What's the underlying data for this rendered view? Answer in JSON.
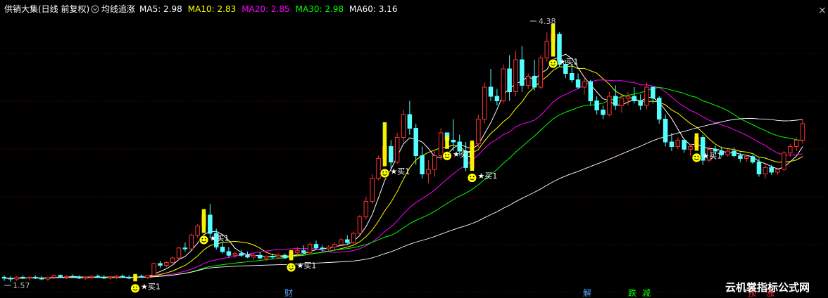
{
  "header": {
    "stock_title": "供销大集(日线 前复权)",
    "indicator_name": "均线追涨",
    "ma_labels": [
      {
        "text": "MA5: 2.98",
        "color": "#ffffff"
      },
      {
        "text": "MA10: 2.83",
        "color": "#ffff00"
      },
      {
        "text": "MA20: 2.85",
        "color": "#ff00ff"
      },
      {
        "text": "MA30: 2.98",
        "color": "#00ff00"
      },
      {
        "text": "MA60: 3.16",
        "color": "#ffffff"
      }
    ]
  },
  "annotations": {
    "high_label": "4.38",
    "low_label": "1.57",
    "signal_label": "买1"
  },
  "events": [
    {
      "text": "财",
      "color": "#4da6ff"
    },
    {
      "text": "解",
      "color": "#4da6ff"
    },
    {
      "text": "跌",
      "color": "#00ff00"
    },
    {
      "text": "减",
      "color": "#00ff00"
    },
    {
      "text": "预",
      "color": "#ff3333"
    },
    {
      "text": "涨",
      "color": "#ff3333"
    }
  ],
  "watermark": "云机裳指标公式网",
  "colors": {
    "background": "#000000",
    "up": "#ff3232",
    "down": "#54ffff",
    "signal": "#ffff00",
    "grid": "#7a0000"
  },
  "chart_data": {
    "type": "candlestick",
    "title": "",
    "ylim": [
      1.5,
      4.5
    ],
    "high": 4.38,
    "low": 1.57,
    "ohlc": [
      [
        1.62,
        1.64,
        1.58,
        1.61
      ],
      [
        1.61,
        1.63,
        1.57,
        1.6
      ],
      [
        1.6,
        1.63,
        1.58,
        1.62
      ],
      [
        1.62,
        1.64,
        1.6,
        1.61
      ],
      [
        1.61,
        1.63,
        1.59,
        1.62
      ],
      [
        1.62,
        1.64,
        1.6,
        1.61
      ],
      [
        1.61,
        1.63,
        1.59,
        1.6
      ],
      [
        1.6,
        1.62,
        1.58,
        1.62
      ],
      [
        1.62,
        1.65,
        1.6,
        1.64
      ],
      [
        1.64,
        1.65,
        1.61,
        1.62
      ],
      [
        1.62,
        1.64,
        1.6,
        1.63
      ],
      [
        1.63,
        1.65,
        1.61,
        1.62
      ],
      [
        1.62,
        1.64,
        1.6,
        1.61
      ],
      [
        1.61,
        1.63,
        1.59,
        1.62
      ],
      [
        1.62,
        1.64,
        1.6,
        1.63
      ],
      [
        1.63,
        1.65,
        1.61,
        1.62
      ],
      [
        1.62,
        1.64,
        1.6,
        1.61
      ],
      [
        1.61,
        1.63,
        1.59,
        1.62
      ],
      [
        1.62,
        1.64,
        1.6,
        1.63
      ],
      [
        1.63,
        1.65,
        1.61,
        1.62
      ],
      [
        1.62,
        1.64,
        1.6,
        1.61
      ],
      [
        1.61,
        1.64,
        1.59,
        1.63
      ],
      [
        1.63,
        1.65,
        1.61,
        1.62
      ],
      [
        1.62,
        1.64,
        1.6,
        1.64
      ],
      [
        1.64,
        1.78,
        1.63,
        1.77
      ],
      [
        1.77,
        1.8,
        1.72,
        1.75
      ],
      [
        1.75,
        1.79,
        1.73,
        1.78
      ],
      [
        1.78,
        1.85,
        1.76,
        1.83
      ],
      [
        1.83,
        1.95,
        1.81,
        1.94
      ],
      [
        1.94,
        2.0,
        1.9,
        1.93
      ],
      [
        1.93,
        2.1,
        1.92,
        2.08
      ],
      [
        2.08,
        2.2,
        2.05,
        2.18
      ],
      [
        2.18,
        2.35,
        2.12,
        2.3
      ],
      [
        2.3,
        2.42,
        2.05,
        2.1
      ],
      [
        2.1,
        2.15,
        1.92,
        1.95
      ],
      [
        1.95,
        2.0,
        1.88,
        1.9
      ],
      [
        1.9,
        1.95,
        1.84,
        1.86
      ],
      [
        1.86,
        1.9,
        1.83,
        1.88
      ],
      [
        1.88,
        1.92,
        1.84,
        1.86
      ],
      [
        1.86,
        1.9,
        1.83,
        1.84
      ],
      [
        1.84,
        1.88,
        1.81,
        1.86
      ],
      [
        1.86,
        1.9,
        1.82,
        1.83
      ],
      [
        1.83,
        1.86,
        1.8,
        1.85
      ],
      [
        1.85,
        1.88,
        1.82,
        1.84
      ],
      [
        1.84,
        1.88,
        1.82,
        1.86
      ],
      [
        1.86,
        1.88,
        1.82,
        1.83
      ],
      [
        1.83,
        1.9,
        1.82,
        1.89
      ],
      [
        1.89,
        1.95,
        1.86,
        1.91
      ],
      [
        1.91,
        1.97,
        1.88,
        1.89
      ],
      [
        1.89,
        2.0,
        1.87,
        1.98
      ],
      [
        1.98,
        2.02,
        1.92,
        1.94
      ],
      [
        1.94,
        1.97,
        1.9,
        1.93
      ],
      [
        1.93,
        1.97,
        1.91,
        1.95
      ],
      [
        1.95,
        2.0,
        1.92,
        1.98
      ],
      [
        1.98,
        2.05,
        1.96,
        2.03
      ],
      [
        2.03,
        2.08,
        1.98,
        2.0
      ],
      [
        2.0,
        2.12,
        1.98,
        2.1
      ],
      [
        2.1,
        2.3,
        2.08,
        2.28
      ],
      [
        2.28,
        2.5,
        2.25,
        2.45
      ],
      [
        2.45,
        2.75,
        2.42,
        2.7
      ],
      [
        2.7,
        2.95,
        2.68,
        2.92
      ],
      [
        2.92,
        3.3,
        2.85,
        3.05
      ],
      [
        3.05,
        3.12,
        2.8,
        2.88
      ],
      [
        2.88,
        3.2,
        2.86,
        3.15
      ],
      [
        3.15,
        3.45,
        3.1,
        3.4
      ],
      [
        3.4,
        3.55,
        3.18,
        3.25
      ],
      [
        3.25,
        3.3,
        2.85,
        2.95
      ],
      [
        2.95,
        3.05,
        2.7,
        2.75
      ],
      [
        2.75,
        2.9,
        2.65,
        2.8
      ],
      [
        2.8,
        3.0,
        2.72,
        2.95
      ],
      [
        2.95,
        3.25,
        2.9,
        3.2
      ],
      [
        3.2,
        3.15,
        3.04,
        3.12
      ],
      [
        3.12,
        3.35,
        3.0,
        3.1
      ],
      [
        3.1,
        3.18,
        2.95,
        3.0
      ],
      [
        3.0,
        3.1,
        2.78,
        2.82
      ],
      [
        2.82,
        3.1,
        2.8,
        3.08
      ],
      [
        3.08,
        3.4,
        3.04,
        3.35
      ],
      [
        3.35,
        3.75,
        3.3,
        3.7
      ],
      [
        3.7,
        3.9,
        3.55,
        3.6
      ],
      [
        3.6,
        3.68,
        3.5,
        3.55
      ],
      [
        3.55,
        3.95,
        3.52,
        3.9
      ],
      [
        3.9,
        4.05,
        3.55,
        3.65
      ],
      [
        3.65,
        4.1,
        3.6,
        4.0
      ],
      [
        4.0,
        4.15,
        3.65,
        3.72
      ],
      [
        3.72,
        3.85,
        3.68,
        3.82
      ],
      [
        3.82,
        4.0,
        3.66,
        3.7
      ],
      [
        3.7,
        4.05,
        3.68,
        4.02
      ],
      [
        4.02,
        4.3,
        3.98,
        4.2
      ],
      [
        4.2,
        4.38,
        4.05,
        4.28
      ],
      [
        4.28,
        4.3,
        3.92,
        3.95
      ],
      [
        3.95,
        4.0,
        3.8,
        3.85
      ],
      [
        3.85,
        3.95,
        3.75,
        3.78
      ],
      [
        3.78,
        3.85,
        3.68,
        3.7
      ],
      [
        3.7,
        3.82,
        3.62,
        3.76
      ],
      [
        3.76,
        3.78,
        3.5,
        3.55
      ],
      [
        3.55,
        3.6,
        3.4,
        3.45
      ],
      [
        3.45,
        3.5,
        3.35,
        3.4
      ],
      [
        3.4,
        3.65,
        3.38,
        3.6
      ],
      [
        3.6,
        3.72,
        3.45,
        3.5
      ],
      [
        3.5,
        3.62,
        3.42,
        3.58
      ],
      [
        3.58,
        3.65,
        3.5,
        3.6
      ],
      [
        3.6,
        3.7,
        3.52,
        3.55
      ],
      [
        3.55,
        3.62,
        3.45,
        3.5
      ],
      [
        3.5,
        3.75,
        3.46,
        3.7
      ],
      [
        3.7,
        3.62,
        3.52,
        3.58
      ],
      [
        3.58,
        3.6,
        3.3,
        3.35
      ],
      [
        3.35,
        3.4,
        3.05,
        3.1
      ],
      [
        3.1,
        3.2,
        3.0,
        3.05
      ],
      [
        3.05,
        3.15,
        3.02,
        3.12
      ],
      [
        3.12,
        3.14,
        2.98,
        3.02
      ],
      [
        3.02,
        3.08,
        2.95,
        3.05
      ],
      [
        3.05,
        3.18,
        3.02,
        3.15
      ],
      [
        3.15,
        3.18,
        2.85,
        2.9
      ],
      [
        2.9,
        3.05,
        2.88,
        3.02
      ],
      [
        3.02,
        3.06,
        2.95,
        3.0
      ],
      [
        3.0,
        3.05,
        2.94,
        2.96
      ],
      [
        2.96,
        3.02,
        2.94,
        3.0
      ],
      [
        3.0,
        3.04,
        2.93,
        2.95
      ],
      [
        2.95,
        2.98,
        2.88,
        2.92
      ],
      [
        2.92,
        2.96,
        2.88,
        2.94
      ],
      [
        2.94,
        2.96,
        2.86,
        2.88
      ],
      [
        2.88,
        2.92,
        2.72,
        2.75
      ],
      [
        2.75,
        2.85,
        2.7,
        2.82
      ],
      [
        2.82,
        2.85,
        2.74,
        2.77
      ],
      [
        2.77,
        2.82,
        2.74,
        2.8
      ],
      [
        2.8,
        3.0,
        2.78,
        2.98
      ],
      [
        2.98,
        3.08,
        2.94,
        3.05
      ],
      [
        3.05,
        3.15,
        3.0,
        3.12
      ],
      [
        3.12,
        3.35,
        3.08,
        3.3
      ]
    ],
    "signals": [
      21,
      32,
      46,
      61,
      71,
      75,
      88,
      111
    ],
    "series": [
      {
        "name": "MA5",
        "period": 5,
        "color": "#ffffff"
      },
      {
        "name": "MA10",
        "period": 10,
        "color": "#ffff00"
      },
      {
        "name": "MA20",
        "period": 20,
        "color": "#ff00ff"
      },
      {
        "name": "MA30",
        "period": 30,
        "color": "#00ff00"
      },
      {
        "name": "MA60",
        "period": 60,
        "color": "#ffffff"
      }
    ]
  }
}
